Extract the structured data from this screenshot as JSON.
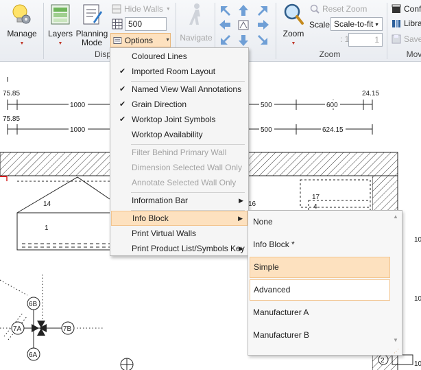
{
  "ribbon": {
    "manage_label": "Manage",
    "layers_label": "Layers",
    "planning_mode_label": "Planning Mode",
    "hide_walls_label": "Hide Walls",
    "wall_height_value": "500",
    "options_label": "Options",
    "display_group_label": "Disp",
    "navigate_label": "Navigate",
    "zoom_label": "Zoom",
    "reset_zoom_label": "Reset Zoom",
    "scale_label": "Scale:",
    "scale_value": "Scale-to-fit",
    "page_value": "1",
    "page_total": ": 1",
    "zoom_group_label": "Zoom",
    "confirm_label": "Confi",
    "library_label": "Libra",
    "save_label": "Save",
    "move_group_label": "Mov"
  },
  "options_menu": {
    "items": [
      {
        "label": "Coloured Lines",
        "checked": false,
        "enabled": true
      },
      {
        "label": "Imported Room Layout",
        "checked": true,
        "enabled": true
      },
      {
        "label": "Named View Wall Annotations",
        "checked": true,
        "enabled": true
      },
      {
        "label": "Grain Direction",
        "checked": true,
        "enabled": true
      },
      {
        "label": "Worktop Joint Symbols",
        "checked": true,
        "enabled": true
      },
      {
        "label": "Worktop Availability",
        "checked": false,
        "enabled": true
      },
      {
        "label": "Filter Behind Primary Wall",
        "checked": false,
        "enabled": false
      },
      {
        "label": "Dimension Selected Wall Only",
        "checked": false,
        "enabled": false
      },
      {
        "label": "Annotate Selected Wall Only",
        "checked": false,
        "enabled": false
      },
      {
        "label": "Information Bar",
        "submenu": true,
        "enabled": true
      },
      {
        "label": "Info Block",
        "submenu": true,
        "enabled": true,
        "highlighted": true
      },
      {
        "label": "Print Virtual Walls",
        "enabled": true
      },
      {
        "label": "Print Product List/Symbols Key",
        "submenu": true,
        "enabled": true
      }
    ]
  },
  "info_block_submenu": {
    "items": [
      {
        "label": "None"
      },
      {
        "label": "Info Block *"
      },
      {
        "label": "Simple",
        "selected": true
      },
      {
        "label": "Advanced",
        "focused": true
      },
      {
        "label": "Manufacturer A"
      },
      {
        "label": "Manufacturer B"
      }
    ]
  },
  "drawing": {
    "dim_left_top": "75.85",
    "dim_left_bottom": "75.85",
    "dim_right_top": "24.15",
    "dim_1000_a": "1000",
    "dim_1000_b": "1000",
    "dim_500_a": "500",
    "dim_500_b": "500",
    "dim_600": "600",
    "dim_624": "624.15",
    "label_14": "14",
    "label_1": "1",
    "label_16": "16",
    "label_17": "17",
    "label_4": "4",
    "label_6B": "6B",
    "label_7A": "7A",
    "label_7B": "7B",
    "label_6A": "6A",
    "label_2": "2",
    "label_10a": "10",
    "label_10b": "10",
    "label_10c": "10"
  },
  "colors": {
    "highlight": "#fde1bf",
    "highlight_border": "#f2c590",
    "accent_red": "#c0392b"
  }
}
